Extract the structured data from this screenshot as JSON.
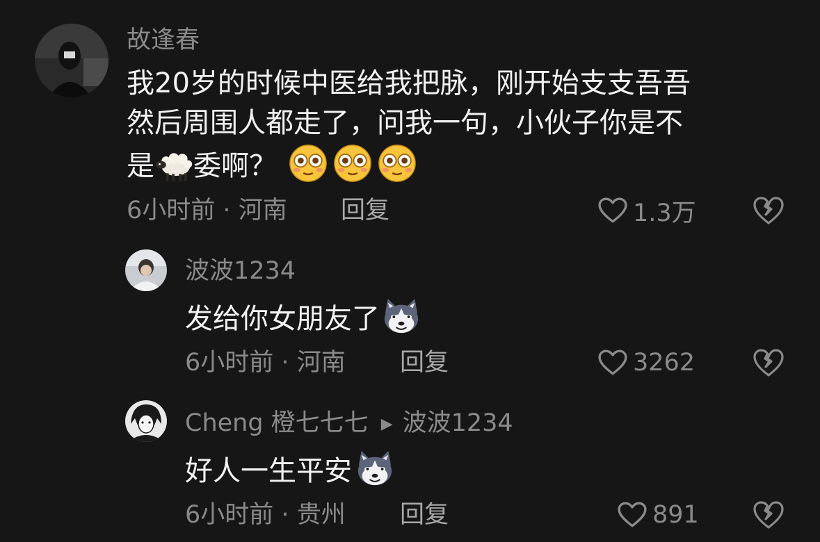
{
  "comments": [
    {
      "username": "故逢春",
      "lines": [
        "我20岁的时候中医给我把脉，刚开始支支吾吾",
        "然后周围人都走了，问我一句，小伙子你是不"
      ],
      "line3_start": "是",
      "line3_end": "委啊？",
      "inline_emoji": "sheep-emoji",
      "trailing_emoji": "flushed-face-emoji",
      "time": "6小时前",
      "location": "河南",
      "reply_label": "回复",
      "likes": "1.3万"
    },
    {
      "username": "波波1234",
      "text": "发给你女朋友了",
      "trailing_emoji": "doge-emoji",
      "time": "6小时前",
      "location": "河南",
      "reply_label": "回复",
      "likes": "3262"
    },
    {
      "username": "Cheng 橙七七七",
      "reply_to": "波波1234",
      "text": "好人一生平安",
      "trailing_emoji": "doge-emoji",
      "time": "6小时前",
      "location": "贵州",
      "reply_label": "回复",
      "likes": "891"
    }
  ],
  "separator": "·",
  "colors": {
    "background": "#161616",
    "text_primary": "#f2f2f2",
    "text_secondary": "#8a8a8a"
  }
}
